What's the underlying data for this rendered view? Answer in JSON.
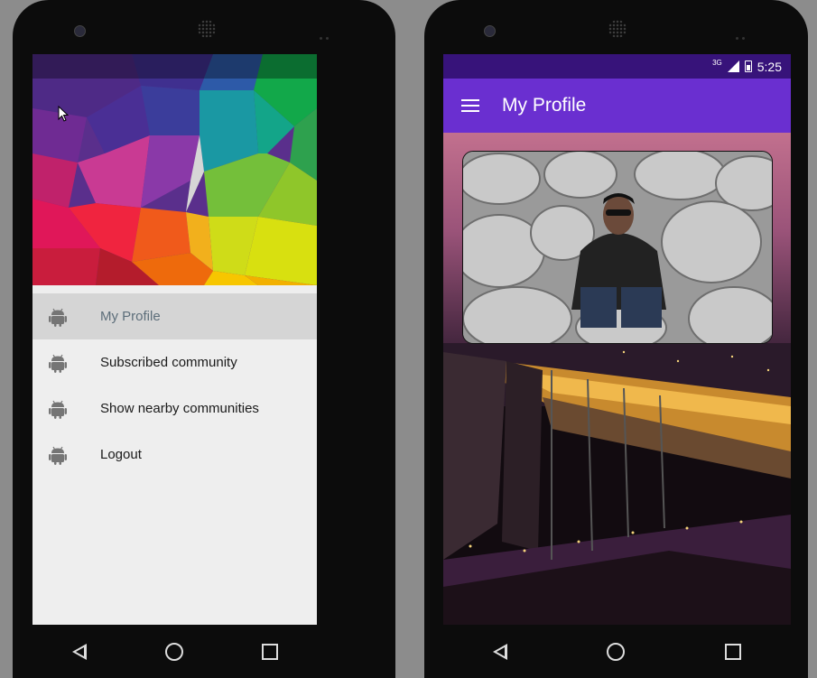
{
  "status_bar": {
    "network": "3G",
    "time": "5:25"
  },
  "drawer": {
    "menu": [
      {
        "label": "My Profile",
        "icon": "android-icon",
        "selected": true
      },
      {
        "label": "Subscribed community",
        "icon": "android-icon",
        "selected": false
      },
      {
        "label": "Show nearby communities",
        "icon": "android-icon",
        "selected": false
      },
      {
        "label": "Logout",
        "icon": "android-icon",
        "selected": false
      }
    ]
  },
  "main": {
    "title": "My Profile",
    "menu_icon": "hamburger-icon"
  },
  "navbar": {
    "icons": [
      "back-icon",
      "home-icon",
      "recent-apps-icon"
    ]
  },
  "colors": {
    "appbar": "#6a2fd0",
    "statusbar": "#37137a",
    "drawer_bg": "#eeeeee",
    "selected_item": "#d5d5d5"
  }
}
